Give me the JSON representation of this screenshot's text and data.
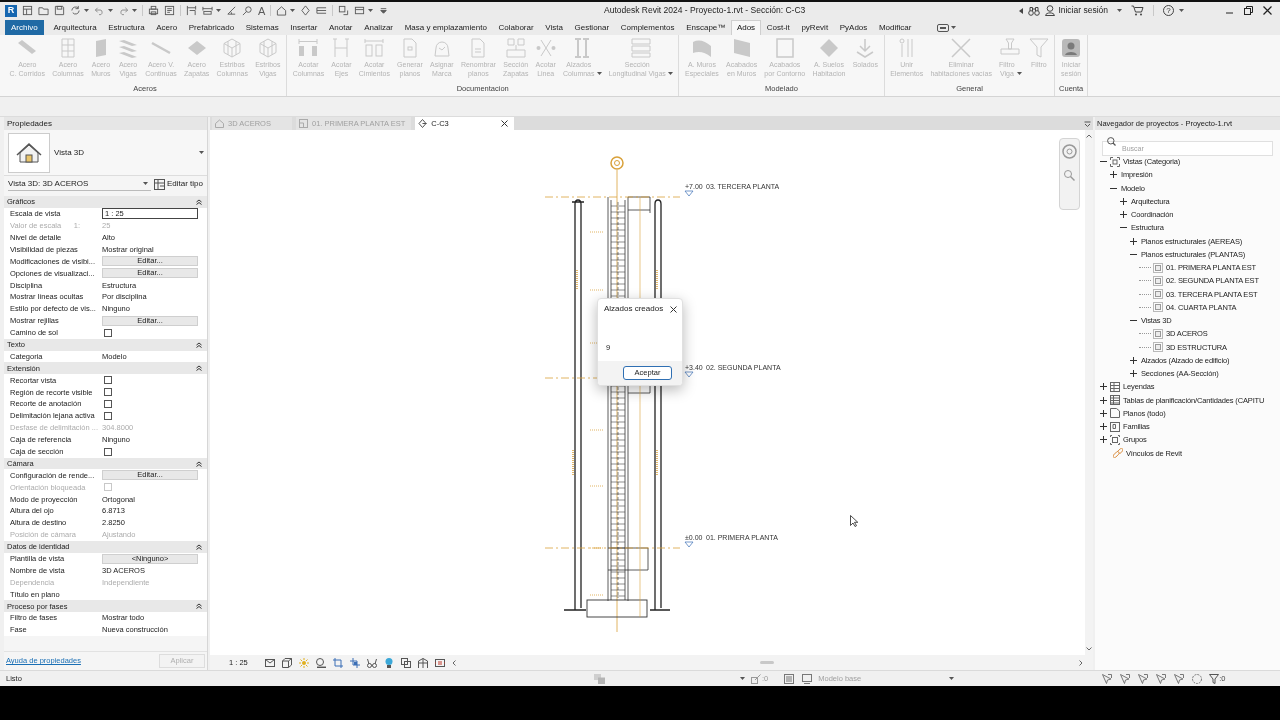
{
  "title_bar": {
    "logo": "R",
    "text_tool": "A",
    "title": "Autodesk Revit 2024 - Proyecto-1.rvt - Sección: C-C3",
    "sign_in": "Iniciar sesión",
    "help": "?"
  },
  "ribbon_tabs": {
    "file_menu": "Archivo",
    "tabs": [
      {
        "label": "Arquitectura",
        "selected": false
      },
      {
        "label": "Estructura",
        "selected": false
      },
      {
        "label": "Acero",
        "selected": false
      },
      {
        "label": "Prefabricado",
        "selected": false
      },
      {
        "label": "Sistemas",
        "selected": false
      },
      {
        "label": "Insertar",
        "selected": false
      },
      {
        "label": "Anotar",
        "selected": false
      },
      {
        "label": "Analizar",
        "selected": false
      },
      {
        "label": "Masa y emplazamiento",
        "selected": false
      },
      {
        "label": "Colaborar",
        "selected": false
      },
      {
        "label": "Vista",
        "selected": false
      },
      {
        "label": "Gestionar",
        "selected": false
      },
      {
        "label": "Complementos",
        "selected": false
      },
      {
        "label": "Enscape™",
        "selected": false
      },
      {
        "label": "Ados",
        "selected": true
      },
      {
        "label": "Cost-it",
        "selected": false
      },
      {
        "label": "pyRevit",
        "selected": false
      },
      {
        "label": "PyAdos",
        "selected": false
      },
      {
        "label": "Modificar",
        "selected": false
      }
    ]
  },
  "ribbon": {
    "disabled": true,
    "panels": [
      {
        "title": "Aceros",
        "buttons": [
          {
            "label": "Acero\nC. Corridos"
          },
          {
            "label": "Acero\nColumnas"
          },
          {
            "label": "Acero\nMuros"
          },
          {
            "label": "Acero\nVigas"
          },
          {
            "label": "Acero V.\nContinuas"
          },
          {
            "label": "Acero\nZapatas"
          },
          {
            "label": "Estribos\nColumnas"
          },
          {
            "label": "Estribos\nVigas"
          }
        ]
      },
      {
        "title": "Documentacion",
        "buttons": [
          {
            "label": "Acotar\nColumnas"
          },
          {
            "label": "Acotar\nEjes"
          },
          {
            "label": "Acotar\nCimientos"
          },
          {
            "label": "Generar\nplanos"
          },
          {
            "label": "Asignar\nMarca"
          },
          {
            "label": "Renombrar\nplanos"
          },
          {
            "label": "Sección\nZapatas"
          },
          {
            "label": "Acotar\nLinea"
          },
          {
            "label": "Alzados\nColumnas",
            "dropdown": true
          },
          {
            "label": "Sección\nLongitudinal Vigas",
            "dropdown": true
          }
        ]
      },
      {
        "title": "Modelado",
        "buttons": [
          {
            "label": "A. Muros\nEspeciales"
          },
          {
            "label": "Acabados\nen Muros"
          },
          {
            "label": "Acabados\npor Contorno"
          },
          {
            "label": "A. Suelos\nHabitacion"
          },
          {
            "label": "Solados"
          }
        ]
      },
      {
        "title": "General",
        "buttons": [
          {
            "label": "Unir\nElementos"
          },
          {
            "label": "Eliminar\nhabitaciones vacías"
          },
          {
            "label": "Filtro\nViga",
            "dropdown": true
          },
          {
            "label": "Filtro"
          }
        ]
      },
      {
        "title": "Cuenta",
        "buttons": [
          {
            "label": "Iniciar\nsesión"
          }
        ]
      }
    ]
  },
  "properties": {
    "title": "Propiedades",
    "type": "Vista 3D",
    "instance": "Vista 3D: 3D ACEROS",
    "edit_type": "Editar tipo",
    "groups": [
      {
        "name": "Gráficos",
        "expanded": true,
        "rows": [
          {
            "label": "Escala de vista",
            "value": "1 : 25",
            "kind": "input",
            "disabled": false
          },
          {
            "label": "Valor de escala",
            "suffix": "1:",
            "value": "25",
            "kind": "text",
            "disabled": true
          },
          {
            "label": "Nivel de detalle",
            "value": "Alto",
            "kind": "text",
            "disabled": false
          },
          {
            "label": "Visibilidad de piezas",
            "value": "Mostrar original",
            "kind": "text",
            "disabled": false
          },
          {
            "label": "Modificaciones de visibi...",
            "value": "Editar...",
            "kind": "button",
            "disabled": false
          },
          {
            "label": "Opciones de visualizaci...",
            "value": "Editar...",
            "kind": "button",
            "disabled": false
          },
          {
            "label": "Disciplina",
            "value": "Estructura",
            "kind": "text",
            "disabled": false
          },
          {
            "label": "Mostrar líneas ocultas",
            "value": "Por disciplina",
            "kind": "text",
            "disabled": false
          },
          {
            "label": "Estilo por defecto de vis...",
            "value": "Ninguno",
            "kind": "text",
            "disabled": false
          },
          {
            "label": "Mostrar rejillas",
            "value": "Editar...",
            "kind": "button",
            "disabled": false
          },
          {
            "label": "Camino de sol",
            "kind": "checkbox",
            "checked": false,
            "disabled": false
          }
        ]
      },
      {
        "name": "Texto",
        "expanded": true,
        "rows": [
          {
            "label": "Categoria",
            "value": "Modelo",
            "kind": "text",
            "disabled": false
          }
        ]
      },
      {
        "name": "Extensión",
        "expanded": true,
        "rows": [
          {
            "label": "Recortar vista",
            "kind": "checkbox",
            "checked": false,
            "disabled": false
          },
          {
            "label": "Región de recorte visible",
            "kind": "checkbox",
            "checked": false,
            "disabled": false
          },
          {
            "label": "Recorte de anotación",
            "kind": "checkbox",
            "checked": false,
            "disabled": false
          },
          {
            "label": "Delimitación lejana activa",
            "kind": "checkbox",
            "checked": false,
            "disabled": false
          },
          {
            "label": "Desfase de delimitación ...",
            "value": "304.8000",
            "kind": "text",
            "disabled": true
          },
          {
            "label": "Caja de referencia",
            "value": "Ninguno",
            "kind": "text",
            "disabled": false
          },
          {
            "label": "Caja de sección",
            "kind": "checkbox",
            "checked": false,
            "disabled": false
          }
        ]
      },
      {
        "name": "Cámara",
        "expanded": true,
        "rows": [
          {
            "label": "Configuración de rende...",
            "value": "Editar...",
            "kind": "button",
            "disabled": false
          },
          {
            "label": "Orientación bloqueada",
            "kind": "checkbox",
            "checked": false,
            "disabled": true
          },
          {
            "label": "Modo de proyección",
            "value": "Ortogonal",
            "kind": "text",
            "disabled": false
          },
          {
            "label": "Altura del ojo",
            "value": "6.8713",
            "kind": "text",
            "disabled": false
          },
          {
            "label": "Altura de destino",
            "value": "2.8250",
            "kind": "text",
            "disabled": false
          },
          {
            "label": "Posición de cámara",
            "value": "Ajustando",
            "kind": "text",
            "disabled": true
          }
        ]
      },
      {
        "name": "Datos de identidad",
        "expanded": true,
        "rows": [
          {
            "label": "Plantilla de vista",
            "value": "<Ninguno>",
            "kind": "button",
            "disabled": false
          },
          {
            "label": "Nombre de vista",
            "value": "3D ACEROS",
            "kind": "text",
            "disabled": false
          },
          {
            "label": "Dependencia",
            "value": "Independiente",
            "kind": "text",
            "disabled": true
          },
          {
            "label": "Título en plano",
            "kind": "text",
            "disabled": false
          }
        ]
      },
      {
        "name": "Proceso por fases",
        "expanded": true,
        "rows": [
          {
            "label": "Filtro de fases",
            "value": "Mostrar todo",
            "kind": "text",
            "disabled": false
          },
          {
            "label": "Fase",
            "value": "Nueva construcción",
            "kind": "text",
            "disabled": false
          }
        ]
      }
    ],
    "help_link": "Ayuda de propiedades",
    "apply": {
      "label": "Aplicar",
      "disabled": true
    }
  },
  "view_tabs": [
    {
      "label": "3D ACEROS",
      "kind": "axonometric",
      "selected": false
    },
    {
      "label": "01. PRIMERA PLANTA EST",
      "kind": "plan",
      "selected": false
    },
    {
      "label": "C-C3",
      "kind": "section",
      "selected": true
    }
  ],
  "view": {
    "levels": [
      {
        "elevation": "+7.00",
        "name": "03. TERCERA PLANTA"
      },
      {
        "elevation": "+3.40",
        "name": "02. SEGUNDA PLANTA"
      },
      {
        "elevation": "±0.00",
        "name": "01. PRIMERA PLANTA"
      }
    ],
    "scale": "1 : 25"
  },
  "dialog": {
    "title": "Alzados creados",
    "message": "9",
    "button": "Aceptar"
  },
  "project_browser": {
    "title": "Navegador de proyectos - Proyecto-1.rvt",
    "placeholder": "Buscar",
    "tree": [
      {
        "label": "Vistas (Categoria)",
        "kind": "category",
        "expanded": true,
        "children": [
          {
            "label": "Impresión",
            "expanded": false
          },
          {
            "label": "Modelo",
            "expanded": true,
            "children": [
              {
                "label": "Arquitectura",
                "expanded": false
              },
              {
                "label": "Coordinación",
                "expanded": false
              },
              {
                "label": "Estructura",
                "expanded": true,
                "children": [
                  {
                    "label": "Planos estructurales (AEREAS)",
                    "expanded": false
                  },
                  {
                    "label": "Planos estructurales (PLANTAS)",
                    "expanded": true,
                    "children": [
                      {
                        "label": "01. PRIMERA PLANTA EST",
                        "kind": "view"
                      },
                      {
                        "label": "02. SEGUNDA PLANTA EST",
                        "kind": "view"
                      },
                      {
                        "label": "03. TERCERA PLANTA EST",
                        "kind": "view"
                      },
                      {
                        "label": "04. CUARTA PLANTA",
                        "kind": "view"
                      }
                    ]
                  },
                  {
                    "label": "Vistas 3D",
                    "expanded": true,
                    "children": [
                      {
                        "label": "3D ACEROS",
                        "kind": "view"
                      },
                      {
                        "label": "3D ESTRUCTURA",
                        "kind": "view"
                      }
                    ]
                  },
                  {
                    "label": "Alzados (Alzado de edificio)",
                    "expanded": false
                  },
                  {
                    "label": "Secciones (AA-Sección)",
                    "expanded": false
                  }
                ]
              }
            ]
          }
        ]
      },
      {
        "label": "Leyendas",
        "kind": "legend",
        "expanded": false
      },
      {
        "label": "Tablas de planificación/Cantidades (CAPITU",
        "kind": "schedule",
        "expanded": false
      },
      {
        "label": "Planos (todo)",
        "kind": "sheet",
        "expanded": false
      },
      {
        "label": "Familias",
        "kind": "family",
        "expanded": false
      },
      {
        "label": "Grupos",
        "kind": "group",
        "expanded": false
      },
      {
        "label": "Vínculos de Revit",
        "kind": "link"
      }
    ]
  },
  "status_bar": {
    "message": "Listo",
    "editable_count": ":0",
    "design_option": "Modelo base",
    "filter_count": ":0"
  }
}
